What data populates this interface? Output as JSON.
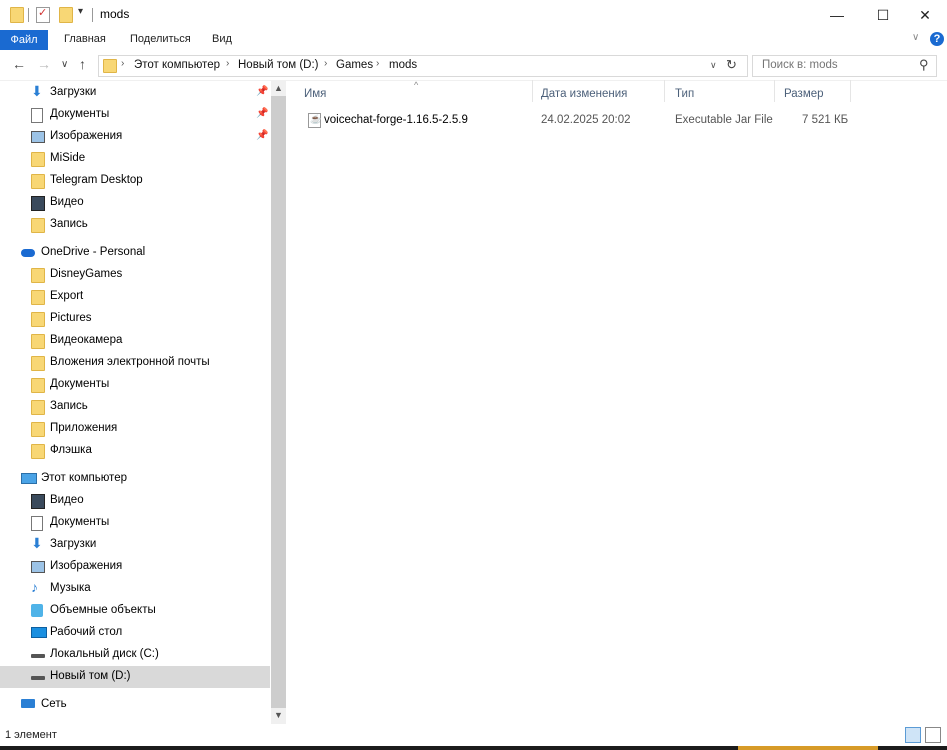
{
  "window": {
    "title": "mods",
    "minimize_glyph": "—",
    "maximize_glyph": "☐",
    "close_glyph": "✕"
  },
  "ribbon": {
    "file_tab": "Файл",
    "tabs": [
      "Главная",
      "Поделиться",
      "Вид"
    ],
    "help_glyph": "?",
    "collapse_glyph": "∨"
  },
  "nav": {
    "back": "←",
    "forward": "→",
    "recent": "∨",
    "up": "↑",
    "breadcrumb": [
      "Этот компьютер",
      "Новый том (D:)",
      "Games",
      "mods"
    ],
    "separator": "›",
    "dropdown_glyph": "∨",
    "refresh_glyph": "↻",
    "search_placeholder": "Поиск в: mods",
    "search_glyph": "⚲"
  },
  "sidebar": {
    "quick_access": [
      {
        "label": "Загрузки",
        "icon": "download-icon",
        "pinned": true
      },
      {
        "label": "Документы",
        "icon": "documents-icon",
        "pinned": true
      },
      {
        "label": "Изображения",
        "icon": "pictures-icon",
        "pinned": true
      },
      {
        "label": "MiSide",
        "icon": "folder-icon",
        "pinned": false
      },
      {
        "label": "Telegram Desktop",
        "icon": "folder-icon",
        "pinned": false
      },
      {
        "label": "Видео",
        "icon": "video-icon",
        "pinned": false
      },
      {
        "label": "Запись",
        "icon": "folder-icon",
        "pinned": false
      }
    ],
    "onedrive": {
      "label": "OneDrive - Personal",
      "items": [
        "DisneyGames",
        "Export",
        "Pictures",
        "Видеокамера",
        "Вложения электронной почты",
        "Документы",
        "Запись",
        "Приложения",
        "Флэшка"
      ]
    },
    "this_pc": {
      "label": "Этот компьютер",
      "items": [
        {
          "label": "Видео",
          "icon": "video-icon"
        },
        {
          "label": "Документы",
          "icon": "documents-icon"
        },
        {
          "label": "Загрузки",
          "icon": "download-icon"
        },
        {
          "label": "Изображения",
          "icon": "pictures-icon"
        },
        {
          "label": "Музыка",
          "icon": "music-icon"
        },
        {
          "label": "Объемные объекты",
          "icon": "3d-objects-icon"
        },
        {
          "label": "Рабочий стол",
          "icon": "desktop-icon"
        },
        {
          "label": "Локальный диск (C:)",
          "icon": "drive-icon"
        },
        {
          "label": "Новый том (D:)",
          "icon": "drive-icon"
        }
      ]
    },
    "network": {
      "label": "Сеть"
    },
    "pin_glyph": "✎"
  },
  "columns": {
    "name": "Имя",
    "date": "Дата изменения",
    "type": "Тип",
    "size": "Размер",
    "sort_glyph": "^"
  },
  "files": [
    {
      "name": "voicechat-forge-1.16.5-2.5.9",
      "date": "24.02.2025 20:02",
      "type": "Executable Jar File",
      "size": "7 521 КБ"
    }
  ],
  "status": {
    "count": "1 элемент"
  },
  "colors": {
    "accent": "#1a6ad1",
    "folder": "#f8d775",
    "selection": "#d9d9d9",
    "header_text": "#4c607a"
  }
}
